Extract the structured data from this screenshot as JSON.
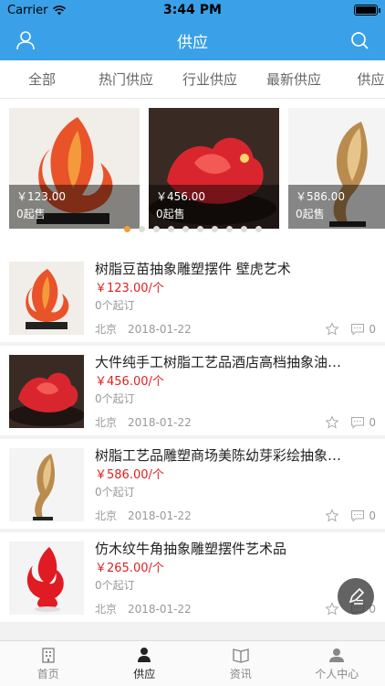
{
  "status": {
    "carrier": "Carrier",
    "time": "3:44 PM"
  },
  "nav": {
    "title": "供应"
  },
  "tabs": [
    "全部",
    "热门供应",
    "行业供应",
    "最新供应",
    "供应商"
  ],
  "carousel": [
    {
      "price": "￥123.00",
      "min": "0起售"
    },
    {
      "price": "￥456.00",
      "min": "0起售"
    },
    {
      "price": "￥586.00",
      "min": "0起售"
    }
  ],
  "dots": {
    "count": 10,
    "active": 0
  },
  "products": [
    {
      "name": "树脂豆苗抽象雕塑摆件 壁虎艺术",
      "price": "￥123.00/个",
      "min": "0个起订",
      "city": "北京",
      "date": "2018-01-22",
      "comments": "0"
    },
    {
      "name": "大件纯手工树脂工艺品酒店高档抽象油…",
      "price": "￥456.00/个",
      "min": "0个起订",
      "city": "北京",
      "date": "2018-01-22",
      "comments": "0"
    },
    {
      "name": "树脂工艺品雕塑商场美陈幼芽彩绘抽象…",
      "price": "￥586.00/个",
      "min": "0个起订",
      "city": "北京",
      "date": "2018-01-22",
      "comments": "0"
    },
    {
      "name": "仿木纹牛角抽象雕塑摆件艺术品",
      "price": "￥265.00/个",
      "min": "0个起订",
      "city": "北京",
      "date": "2018-01-22",
      "comments": "0"
    }
  ],
  "tabbar": [
    {
      "label": "首页",
      "icon": "building-icon"
    },
    {
      "label": "供应",
      "icon": "supply-icon"
    },
    {
      "label": "资讯",
      "icon": "book-icon"
    },
    {
      "label": "个人中心",
      "icon": "user-center-icon"
    }
  ],
  "colors": {
    "primary": "#3aa0e8",
    "price": "#e02020",
    "dot_active": "#f39c3a"
  }
}
